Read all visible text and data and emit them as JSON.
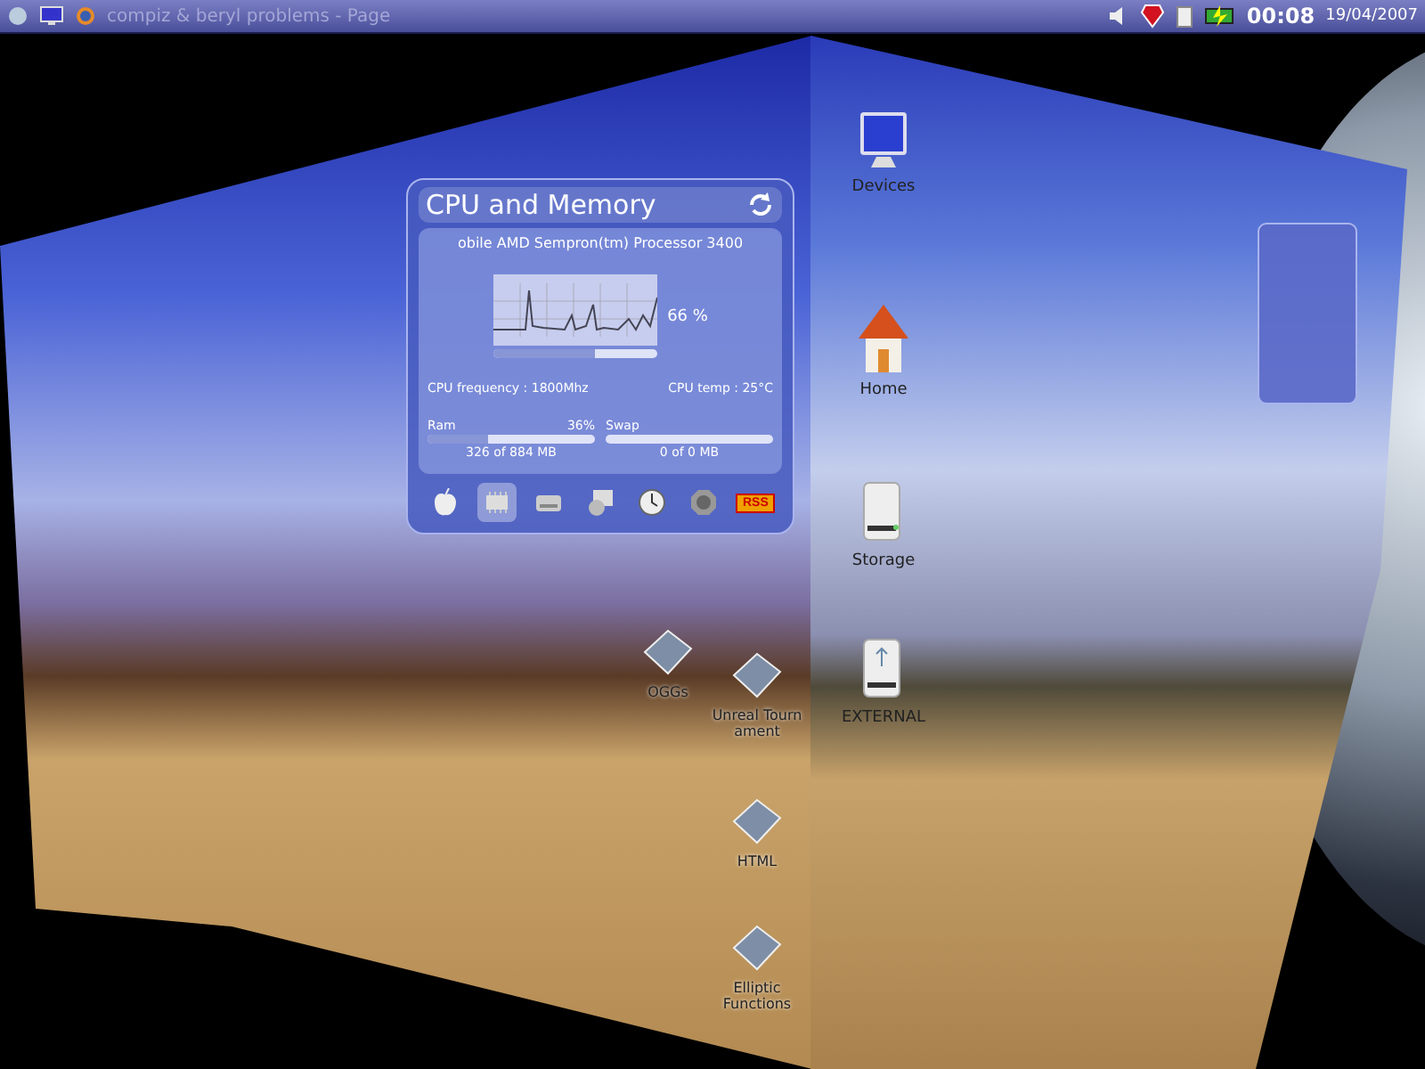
{
  "top_panel": {
    "window_task": "compiz & beryl problems - Page",
    "clock": "00:08",
    "date": "19/04/2007"
  },
  "cpu_widget": {
    "title": "CPU and Memory",
    "processor": "obile AMD Sempron(tm) Processor 3400",
    "cpu_usage": {
      "level": 0.62
    },
    "cpu_percent": "66 %",
    "frequency": "CPU frequency : 1800Mhz",
    "temperature": "CPU temp : 25°C",
    "ram": {
      "label": "Ram",
      "percent": "36%",
      "level": 0.36,
      "usage": "326 of 884 MB"
    },
    "swap": {
      "label": "Swap",
      "level": 0,
      "usage": "0 of 0 MB"
    },
    "dock": [
      {
        "kind": "apple",
        "selected": false
      },
      {
        "kind": "chip",
        "selected": true
      },
      {
        "kind": "drive",
        "selected": false
      },
      {
        "kind": "network",
        "selected": false
      },
      {
        "kind": "clock",
        "selected": false
      },
      {
        "kind": "speaker",
        "selected": false
      },
      {
        "kind": "rss",
        "label": "RSS",
        "selected": false
      }
    ]
  },
  "left_desktop_icons": [
    {
      "label": "OGGs"
    },
    {
      "label": "Unreal Tourn ament"
    },
    {
      "label": "HTML"
    },
    {
      "label": "Elliptic Functions"
    }
  ],
  "right_desktop_icons": [
    {
      "kind": "monitor",
      "label": "Devices"
    },
    {
      "kind": "home",
      "label": "Home"
    },
    {
      "kind": "drive",
      "label": "Storage"
    },
    {
      "kind": "usb-drive",
      "label": "EXTERNAL"
    }
  ]
}
